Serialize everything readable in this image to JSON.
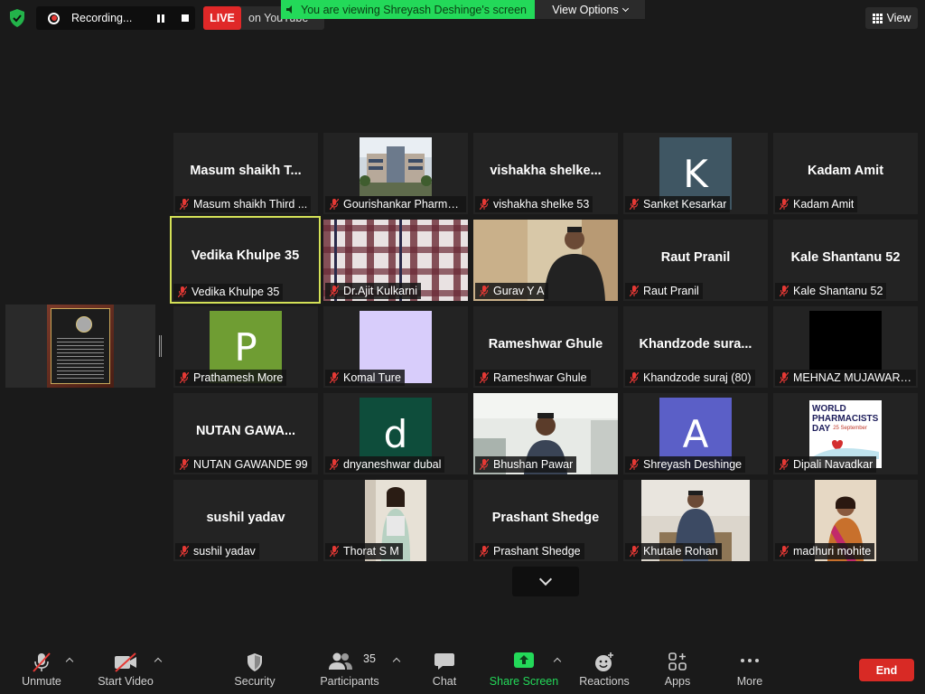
{
  "topbar": {
    "recording_label": "Recording...",
    "live_badge": "LIVE",
    "live_platform": "on YouTube",
    "viewing_banner": "You are viewing Shreyash Deshinge's screen",
    "view_options": "View Options",
    "view_button": "View"
  },
  "colors": {
    "banner_green": "#23d959",
    "live_red": "#e02828",
    "end_red": "#d82a25",
    "active_border": "#d4e157"
  },
  "tiles": [
    {
      "name": "Masum shaikh T...",
      "label": "Masum shaikh Third ...",
      "type": "name"
    },
    {
      "name": "",
      "label": "Gourishankar Pharma...",
      "type": "photo-building"
    },
    {
      "name": "vishakha  shelke...",
      "label": "vishakha shelke 53",
      "type": "name"
    },
    {
      "name": "K",
      "label": "Sanket Kesarkar",
      "type": "avatar",
      "color": "#3f5663"
    },
    {
      "name": "Kadam Amit",
      "label": "Kadam Amit",
      "type": "name"
    },
    {
      "name": "Vedika Khulpe 35",
      "label": "Vedika Khulpe 35",
      "type": "name",
      "active": true
    },
    {
      "name": "",
      "label": "Dr.Ajit Kulkarni",
      "type": "video-plaid"
    },
    {
      "name": "",
      "label": "Gurav Y A",
      "type": "video-man"
    },
    {
      "name": "Raut Pranil",
      "label": "Raut Pranil",
      "type": "name"
    },
    {
      "name": "Kale Shantanu 52",
      "label": "Kale Shantanu 52",
      "type": "name"
    },
    {
      "name": "P",
      "label": "Prathamesh More",
      "type": "avatar",
      "color": "#6f9d33"
    },
    {
      "name": "",
      "label": "Komal Ture",
      "type": "avatar",
      "color": "#d8cdfb"
    },
    {
      "name": "Rameshwar Ghule",
      "label": "Rameshwar Ghule",
      "type": "name"
    },
    {
      "name": "Khandzode sura...",
      "label": "Khandzode suraj (80)",
      "type": "name"
    },
    {
      "name": "",
      "label": "MEHNAZ MUJAWAR ...",
      "type": "avatar",
      "color": "#000000"
    },
    {
      "name": "NUTAN GAWA...",
      "label": "NUTAN GAWANDE 99",
      "type": "name"
    },
    {
      "name": "d",
      "label": "dnyaneshwar dubal",
      "type": "avatar",
      "color": "#0e4d3b"
    },
    {
      "name": "",
      "label": "Bhushan Pawar",
      "type": "video-room"
    },
    {
      "name": "A",
      "label": "Shreyash Deshinge",
      "type": "avatar",
      "color": "#5b5fc7"
    },
    {
      "name": "",
      "label": "Dipali Navadkar",
      "type": "pharmacist"
    },
    {
      "name": "sushil yadav",
      "label": "sushil yadav",
      "type": "name"
    },
    {
      "name": "",
      "label": "Thorat S M",
      "type": "photo-woman"
    },
    {
      "name": "Prashant  Shedge",
      "label": "Prashant  Shedge",
      "type": "name"
    },
    {
      "name": "",
      "label": "Khutale Rohan",
      "type": "photo-seated"
    },
    {
      "name": "",
      "label": "madhuri mohite",
      "type": "photo-saree"
    }
  ],
  "pharmacist_day": {
    "line1": "WORLD",
    "line2": "PHARMACISTS",
    "line3": "DAY",
    "date": "25 September"
  },
  "toolbar": {
    "unmute": "Unmute",
    "start_video": "Start Video",
    "security": "Security",
    "participants": "Participants",
    "participants_count": "35",
    "chat": "Chat",
    "share_screen": "Share Screen",
    "reactions": "Reactions",
    "apps": "Apps",
    "more": "More",
    "end": "End"
  }
}
